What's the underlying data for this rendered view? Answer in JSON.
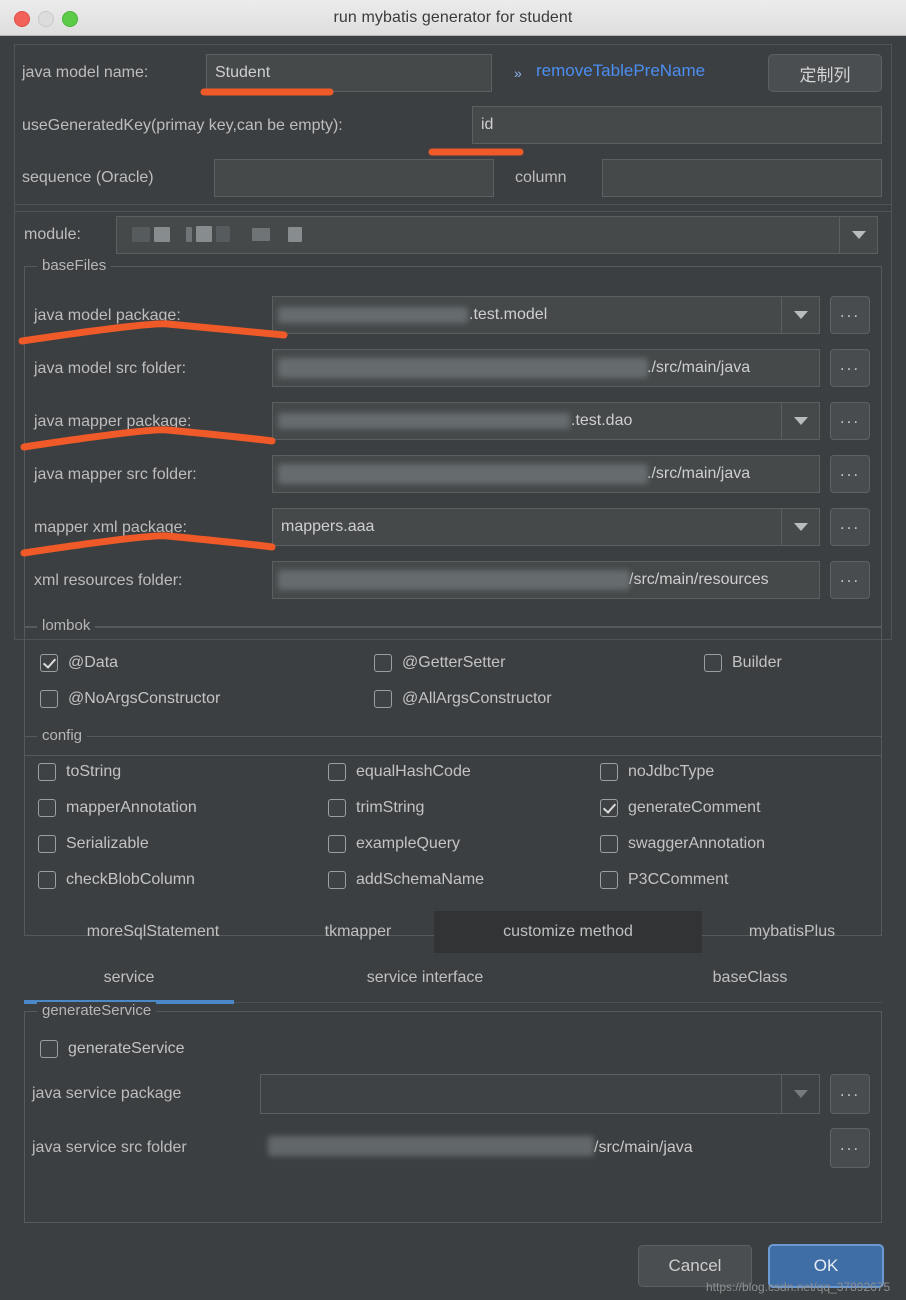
{
  "window": {
    "title": "run mybatis generator for student",
    "traffic_lights": [
      "close-button",
      "minimize-button",
      "zoom-button"
    ]
  },
  "top": {
    "model_name_label": "java model name:",
    "model_name_value": "Student",
    "remove_prefix_link": "removeTablePreName",
    "chevron": "»",
    "custom_column_button": "定制列",
    "generated_key_label": "useGeneratedKey(primay key,can be empty):",
    "generated_key_value": "id",
    "sequence_label": "sequence (Oracle)",
    "sequence_value": "",
    "column_label": "column",
    "column_value": ""
  },
  "module": {
    "label": "module:",
    "value": ""
  },
  "baseFiles": {
    "title": "baseFiles",
    "rows": [
      {
        "label": "java model package:",
        "value": ".test.model",
        "type": "combo",
        "browse": "..."
      },
      {
        "label": "java model src folder:",
        "value": "./src/main/java",
        "type": "text",
        "browse": "..."
      },
      {
        "label": "java mapper package:",
        "value": ".test.dao",
        "type": "combo",
        "browse": "..."
      },
      {
        "label": "java mapper src folder:",
        "value": "./src/main/java",
        "type": "text",
        "browse": "..."
      },
      {
        "label": "mapper xml package:",
        "value": "mappers.aaa",
        "type": "combo",
        "browse": "..."
      },
      {
        "label": "xml resources folder:",
        "value": "/src/main/resources",
        "type": "text",
        "browse": "..."
      }
    ]
  },
  "lombok": {
    "title": "lombok",
    "items": [
      {
        "label": "@Data",
        "checked": true
      },
      {
        "label": "@GetterSetter",
        "checked": false
      },
      {
        "label": "Builder",
        "checked": false
      },
      {
        "label": "@NoArgsConstructor",
        "checked": false
      },
      {
        "label": "@AllArgsConstructor",
        "checked": false
      }
    ]
  },
  "config": {
    "title": "config",
    "items": [
      {
        "label": "toString",
        "checked": false
      },
      {
        "label": "equalHashCode",
        "checked": false
      },
      {
        "label": "noJdbcType",
        "checked": false
      },
      {
        "label": "mapperAnnotation",
        "checked": false
      },
      {
        "label": "trimString",
        "checked": false
      },
      {
        "label": "generateComment",
        "checked": true
      },
      {
        "label": "Serializable",
        "checked": false
      },
      {
        "label": "exampleQuery",
        "checked": false
      },
      {
        "label": "swaggerAnnotation",
        "checked": false
      },
      {
        "label": "checkBlobColumn",
        "checked": false
      },
      {
        "label": "addSchemaName",
        "checked": false
      },
      {
        "label": "P3CComment",
        "checked": false
      }
    ]
  },
  "tabs_row1": [
    {
      "label": "moreSqlStatement",
      "selected": false
    },
    {
      "label": "tkmapper",
      "selected": false
    },
    {
      "label": "customize method",
      "selected": true
    },
    {
      "label": "mybatisPlus",
      "selected": false
    }
  ],
  "tabs_row2": [
    {
      "label": "service",
      "selected": true
    },
    {
      "label": "service interface",
      "selected": false
    },
    {
      "label": "baseClass",
      "selected": false
    }
  ],
  "generateService": {
    "title": "generateService",
    "checkbox_label": "generateService",
    "checkbox_checked": false,
    "package_label": "java service package",
    "package_value": "",
    "src_label": "java service src folder",
    "src_value": "/src/main/java",
    "browse": "..."
  },
  "footer": {
    "cancel_label": "Cancel",
    "ok_label": "OK",
    "watermark": "https://blog.csdn.net/qq_37892675"
  },
  "colors": {
    "accent_blue": "#4a88c7",
    "link_blue": "#4b8ef1",
    "annotation_red": "#ef5a28",
    "panel_bg": "#3c3f41",
    "field_bg": "#45494a"
  }
}
